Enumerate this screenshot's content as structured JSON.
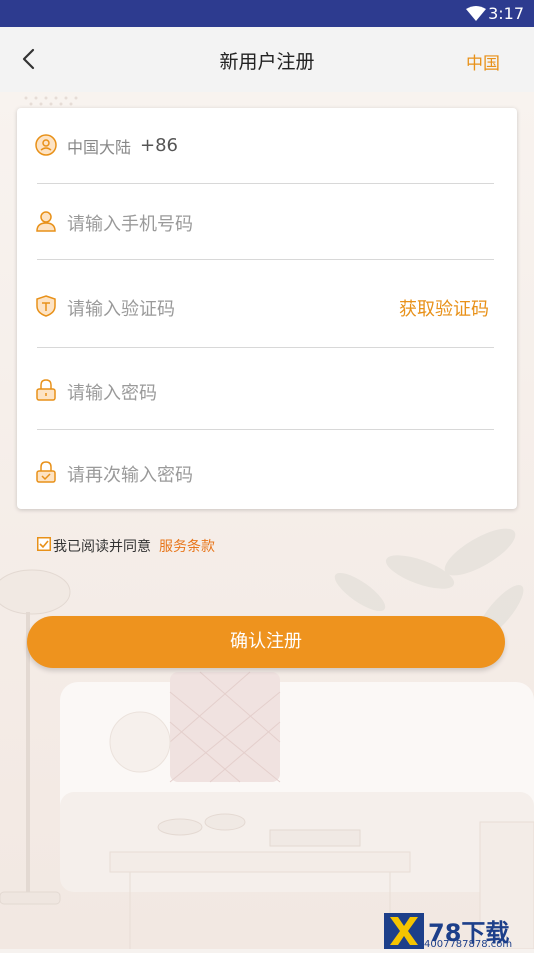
{
  "status_bar": {
    "time": "3:17"
  },
  "nav": {
    "title": "新用户注册",
    "region": "中国"
  },
  "form": {
    "region_label": "中国大陆",
    "country_code": "+86",
    "phone_placeholder": "请输入手机号码",
    "code_placeholder": "请输入验证码",
    "get_code_label": "获取验证码",
    "password_placeholder": "请输入密码",
    "confirm_placeholder": "请再次输入密码"
  },
  "agreement": {
    "text": "我已阅读并同意",
    "terms_link": "服务条款",
    "checked": true
  },
  "submit_label": "确认注册",
  "watermark": {
    "brand": "78下载",
    "url": "4007787878.com"
  },
  "colors": {
    "accent": "#ee931e",
    "status_bar": "#2d3b8f",
    "link": "#e8761b"
  }
}
